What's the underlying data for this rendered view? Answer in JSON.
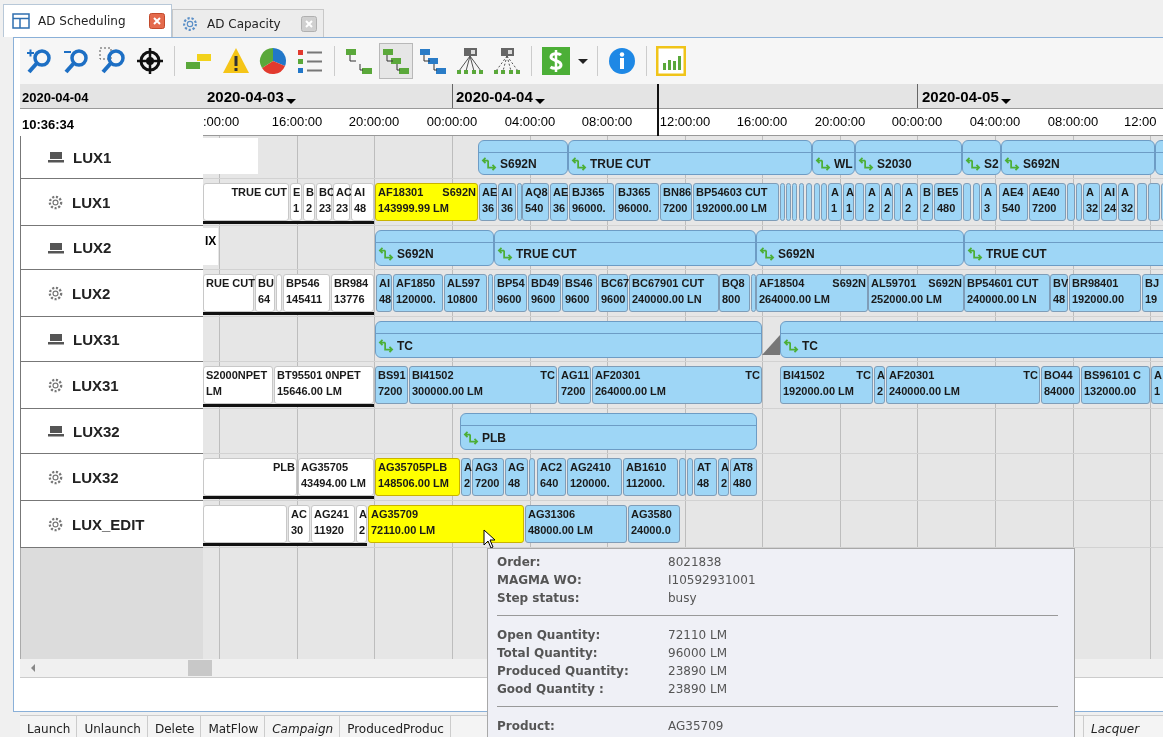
{
  "tabs": [
    {
      "label": "AD Scheduling",
      "selected": true
    },
    {
      "label": "AD Capacity",
      "selected": false
    }
  ],
  "toolbar": [
    {
      "selected": false
    },
    {
      "selected": false
    },
    {
      "selected": false
    },
    {
      "selected": false
    },
    {
      "selected": false
    },
    {
      "selected": false
    },
    {
      "selected": false
    },
    {
      "selected": false
    },
    {
      "selected": false
    },
    {
      "selected": true
    },
    {
      "selected": false
    },
    {
      "selected": false
    },
    {
      "selected": false
    },
    {
      "selected": false
    },
    {
      "selected": false
    },
    {
      "selected": false
    },
    {
      "selected": false
    }
  ],
  "header": {
    "date": "2020-04-04",
    "time": "10:36:34"
  },
  "dates": [
    "2020-04-03",
    "2020-04-04",
    "2020-04-05"
  ],
  "ticks": [
    ":00:00",
    "16:00:00",
    "20:00:00",
    "00:00:00",
    "04:00:00",
    "08:00:00",
    "12:00:00",
    "16:00:00",
    "20:00:00",
    "00:00:00",
    "04:00:00",
    "08:00:00",
    "12:00"
  ],
  "rows": [
    {
      "name": "LUX1",
      "kind": "line",
      "blocks": [
        {
          "kind": "blank"
        },
        {
          "kind": "campaign",
          "text": "S692N"
        },
        {
          "kind": "campaign",
          "text": "TRUE CUT"
        },
        {
          "kind": "campaign",
          "text": "WL"
        },
        {
          "kind": "campaign",
          "text": "S2030"
        },
        {
          "kind": "campaign",
          "text": "S2"
        },
        {
          "kind": "campaign",
          "text": "S692N"
        },
        {
          "kind": "campaign"
        }
      ]
    },
    {
      "name": "LUX1",
      "kind": "machine",
      "blocks": [
        {
          "kind": "done",
          "tag": "TRUE CUT"
        },
        {
          "kind": "done",
          "text": "E",
          "sub": "1"
        },
        {
          "kind": "done",
          "text": "B",
          "sub": "2"
        },
        {
          "kind": "done",
          "text": "BC",
          "sub": "23"
        },
        {
          "kind": "done",
          "text": "AC",
          "sub": "23"
        },
        {
          "kind": "done",
          "text": "AI",
          "sub": "48"
        },
        {
          "kind": "busy",
          "text": "AF18301",
          "tag": "S692N",
          "sub": "143999.99 LM"
        },
        {
          "kind": "planned",
          "text": "AE",
          "sub": "36"
        },
        {
          "kind": "planned",
          "text": "AI",
          "sub": "36"
        },
        {
          "kind": "planned"
        },
        {
          "kind": "planned",
          "text": "AQ8",
          "sub": "540"
        },
        {
          "kind": "planned",
          "text": "AE",
          "sub": "36"
        },
        {
          "kind": "planned",
          "text": "BJ365",
          "sub": "96000."
        },
        {
          "kind": "planned",
          "text": "BJ365",
          "sub": "96000."
        },
        {
          "kind": "planned",
          "text": "BN86",
          "sub": "7200"
        },
        {
          "kind": "planned",
          "text": "BP54603 CUT",
          "sub": "192000.00 LM"
        },
        {
          "kind": "planned"
        },
        {
          "kind": "planned"
        },
        {
          "kind": "planned"
        },
        {
          "kind": "planned"
        },
        {
          "kind": "planned"
        },
        {
          "kind": "planned"
        },
        {
          "kind": "planned"
        },
        {
          "kind": "planned",
          "text": "A",
          "sub": "1"
        },
        {
          "kind": "planned",
          "text": "A",
          "sub": "1"
        },
        {
          "kind": "planned"
        },
        {
          "kind": "planned",
          "text": "A",
          "sub": "2"
        },
        {
          "kind": "planned",
          "text": "A",
          "sub": "2"
        },
        {
          "kind": "planned"
        },
        {
          "kind": "planned",
          "text": "A",
          "sub": "2"
        },
        {
          "kind": "planned",
          "text": "B",
          "sub": "2"
        },
        {
          "kind": "planned",
          "text": "BE5",
          "sub": "480"
        },
        {
          "kind": "planned"
        },
        {
          "kind": "planned"
        },
        {
          "kind": "planned",
          "text": "A",
          "sub": "3"
        },
        {
          "kind": "planned",
          "text": "AE4",
          "sub": "540"
        },
        {
          "kind": "planned",
          "text": "AE40",
          "sub": "7200"
        },
        {
          "kind": "planned"
        },
        {
          "kind": "planned"
        },
        {
          "kind": "planned",
          "text": "A",
          "sub": "32"
        },
        {
          "kind": "planned",
          "text": "AI",
          "sub": "24"
        },
        {
          "kind": "planned",
          "text": "A",
          "sub": "32"
        },
        {
          "kind": "planned"
        },
        {
          "kind": "planned"
        },
        {
          "kind": "planned"
        }
      ]
    },
    {
      "name": "LUX2",
      "kind": "line",
      "blocks": [
        {
          "kind": "blank",
          "text": "IX"
        },
        {
          "kind": "campaign",
          "text": "S692N"
        },
        {
          "kind": "campaign",
          "text": "TRUE CUT"
        },
        {
          "kind": "campaign",
          "text": "S692N"
        },
        {
          "kind": "campaign",
          "text": "TRUE CUT"
        }
      ]
    },
    {
      "name": "LUX2",
      "kind": "machine",
      "blocks": [
        {
          "kind": "done",
          "tag": "RUE CUT"
        },
        {
          "kind": "done",
          "text": "BU",
          "sub": "64"
        },
        {
          "kind": "done"
        },
        {
          "kind": "done",
          "text": "BP546",
          "sub": "145411"
        },
        {
          "kind": "done",
          "text": "BR984",
          "sub": "13776"
        },
        {
          "kind": "planned",
          "text": "AI",
          "sub": "48"
        },
        {
          "kind": "planned",
          "text": "AF1850",
          "sub": "120000."
        },
        {
          "kind": "planned",
          "text": "AL597",
          "sub": "10800"
        },
        {
          "kind": "planned"
        },
        {
          "kind": "planned",
          "text": "BP54",
          "sub": "9600"
        },
        {
          "kind": "planned",
          "text": "BD49",
          "sub": "9600"
        },
        {
          "kind": "planned",
          "text": "BS46",
          "sub": "9600"
        },
        {
          "kind": "planned",
          "text": "BC67",
          "sub": "9600"
        },
        {
          "kind": "planned",
          "text": "BC67901 CUT",
          "sub": "240000.00 LN"
        },
        {
          "kind": "planned",
          "text": "BQ8",
          "sub": "800"
        },
        {
          "kind": "planned"
        },
        {
          "kind": "planned",
          "text": "AF18504",
          "tag": "S692N",
          "sub": "264000.00 LM"
        },
        {
          "kind": "planned",
          "text": "AL59701",
          "tag": "S692N",
          "sub": "252000.00 LM"
        },
        {
          "kind": "planned",
          "text": "BP54601 CUT",
          "sub": "240000.00 LN"
        },
        {
          "kind": "planned",
          "text": "BV",
          "sub": "48"
        },
        {
          "kind": "planned",
          "text": "BR98401",
          "sub": "192000.00"
        },
        {
          "kind": "planned",
          "text": "BJ",
          "sub": "19"
        }
      ]
    },
    {
      "name": "LUX31",
      "kind": "line",
      "blocks": [
        {
          "kind": "campaign",
          "text": "TC"
        },
        {
          "kind": "gap"
        },
        {
          "kind": "campaign",
          "text": "TC"
        }
      ]
    },
    {
      "name": "LUX31",
      "kind": "machine",
      "blocks": [
        {
          "kind": "done",
          "text": "S2000NPET",
          "sub": "LM"
        },
        {
          "kind": "done",
          "text": "BT95501 0NPET",
          "sub": "15646.00 LM"
        },
        {
          "kind": "planned",
          "text": "BS91",
          "sub": "7200"
        },
        {
          "kind": "planned",
          "text": "BI41502",
          "tag": "TC",
          "sub": "300000.00 LM"
        },
        {
          "kind": "planned",
          "text": "AG11",
          "sub": "7200"
        },
        {
          "kind": "planned",
          "text": "AF20301",
          "tag": "TC",
          "sub": "264000.00 LM"
        },
        {
          "kind": "planned",
          "text": "BI41502",
          "tag": "TC",
          "sub": "192000.00 LM"
        },
        {
          "kind": "planned",
          "text": "A",
          "sub": "2"
        },
        {
          "kind": "planned",
          "text": "AF20301",
          "tag": "TC",
          "sub": "240000.00 LM"
        },
        {
          "kind": "planned",
          "text": "BO44",
          "sub": "84000"
        },
        {
          "kind": "planned",
          "text": "BS96101 C",
          "sub": "132000.00"
        },
        {
          "kind": "planned",
          "text": "A",
          "sub": "1"
        }
      ]
    },
    {
      "name": "LUX32",
      "kind": "line",
      "blocks": [
        {
          "kind": "campaign",
          "text": "PLB"
        }
      ]
    },
    {
      "name": "LUX32",
      "kind": "machine",
      "blocks": [
        {
          "kind": "done",
          "tag": "PLB"
        },
        {
          "kind": "done",
          "text": "AG35705",
          "sub": "43494.00 LM"
        },
        {
          "kind": "busy",
          "text": "AG35705PLB",
          "sub": "148506.00 LM"
        },
        {
          "kind": "planned",
          "text": "A",
          "sub": "2"
        },
        {
          "kind": "planned",
          "text": "AG3",
          "sub": "7200"
        },
        {
          "kind": "planned",
          "text": "AG",
          "sub": "48"
        },
        {
          "kind": "planned"
        },
        {
          "kind": "planned",
          "text": "AC2",
          "sub": "640"
        },
        {
          "kind": "planned",
          "text": "AG2410",
          "sub": "120000."
        },
        {
          "kind": "planned",
          "text": "AB1610",
          "sub": "112000."
        },
        {
          "kind": "planned"
        },
        {
          "kind": "planned"
        },
        {
          "kind": "planned",
          "text": "AT",
          "sub": "48"
        },
        {
          "kind": "planned",
          "text": "A",
          "sub": "2"
        },
        {
          "kind": "planned",
          "text": "AT8",
          "sub": "480"
        }
      ]
    },
    {
      "name": "LUX_EDIT",
      "kind": "machine",
      "blocks": [
        {
          "kind": "done"
        },
        {
          "kind": "done",
          "text": "AC",
          "sub": "30"
        },
        {
          "kind": "done",
          "text": "AG241",
          "sub": "11920"
        },
        {
          "kind": "done",
          "text": "A",
          "sub": "2"
        },
        {
          "kind": "busy",
          "text": "AG35709",
          "sub": "72110.00 LM"
        },
        {
          "kind": "planned",
          "text": "AG31306",
          "sub": "48000.00 LM"
        },
        {
          "kind": "planned",
          "text": "AG3580",
          "sub": "24000.0"
        }
      ]
    }
  ],
  "tooltip": {
    "groups": [
      [
        {
          "label": "Order:",
          "value": "8021838"
        },
        {
          "label": "MAGMA WO:",
          "value": "I10592931001"
        },
        {
          "label": "Step status:",
          "value": "busy"
        }
      ],
      [
        {
          "label": "Open Quantity:",
          "value": "72110 LM"
        },
        {
          "label": "Total Quantity:",
          "value": "96000 LM"
        },
        {
          "label": "Produced Quantity:",
          "value": "23890 LM"
        },
        {
          "label": "Good Quantity :",
          "value": "23890 LM"
        }
      ],
      [
        {
          "label": "Product:",
          "value": "AG35709"
        }
      ]
    ]
  },
  "bottom_tabs": [
    {
      "label": "Launch",
      "italic": false
    },
    {
      "label": "Unlaunch",
      "italic": false
    },
    {
      "label": "Delete",
      "italic": false
    },
    {
      "label": "MatFlow",
      "italic": false
    },
    {
      "label": "Campaign",
      "italic": true
    },
    {
      "label": "ProducedProduc",
      "italic": false
    },
    {
      "label": "Lacquer",
      "italic": true
    }
  ]
}
